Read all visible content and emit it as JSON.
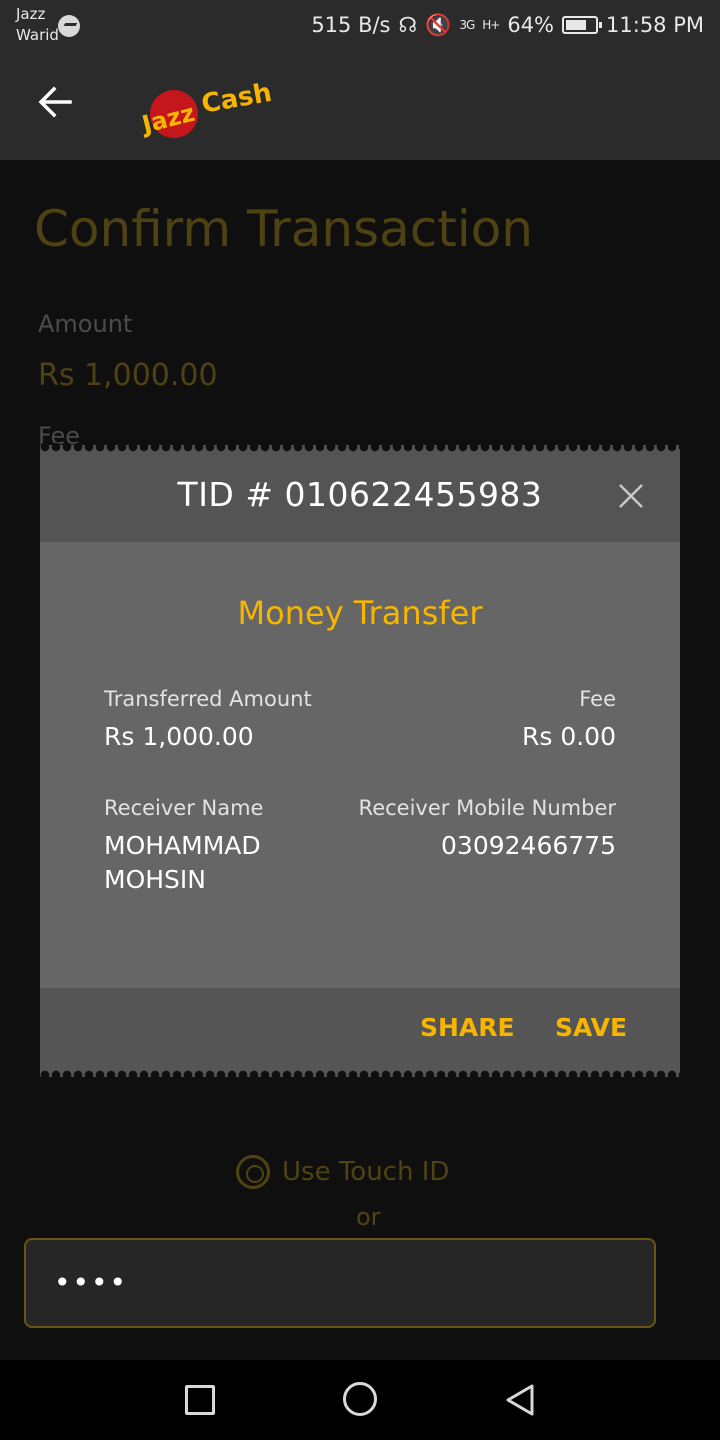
{
  "status_bar": {
    "carrier_line1": "Jazz",
    "carrier_line2": "Warid",
    "net_speed": "515 B/s",
    "signal1": "3G",
    "signal2": "H+",
    "battery": "64%",
    "time": "11:58 PM"
  },
  "app_bar": {
    "logo_text": "JazzCash"
  },
  "background_page": {
    "title": "Confirm Transaction",
    "amount_label": "Amount",
    "amount_value": "Rs 1,000.00",
    "fee_label": "Fee",
    "touch_id_label": "Use Touch ID",
    "or_label": "or",
    "pin_value": "••••"
  },
  "dialog": {
    "tid": "TID # 010622455983",
    "heading": "Money Transfer",
    "transferred_amount_label": "Transferred Amount",
    "transferred_amount_value": "Rs 1,000.00",
    "fee_label": "Fee",
    "fee_value": "Rs 0.00",
    "receiver_name_label": "Receiver Name",
    "receiver_name_line1": "MOHAMMAD",
    "receiver_name_line2": "MOHSIN",
    "receiver_mobile_label": "Receiver Mobile Number",
    "receiver_mobile_value": "03092466775",
    "share_label": "SHARE",
    "save_label": "SAVE"
  },
  "colors": {
    "accent": "#f7b500",
    "dialog_header": "#545454",
    "dialog_body": "#666666"
  }
}
